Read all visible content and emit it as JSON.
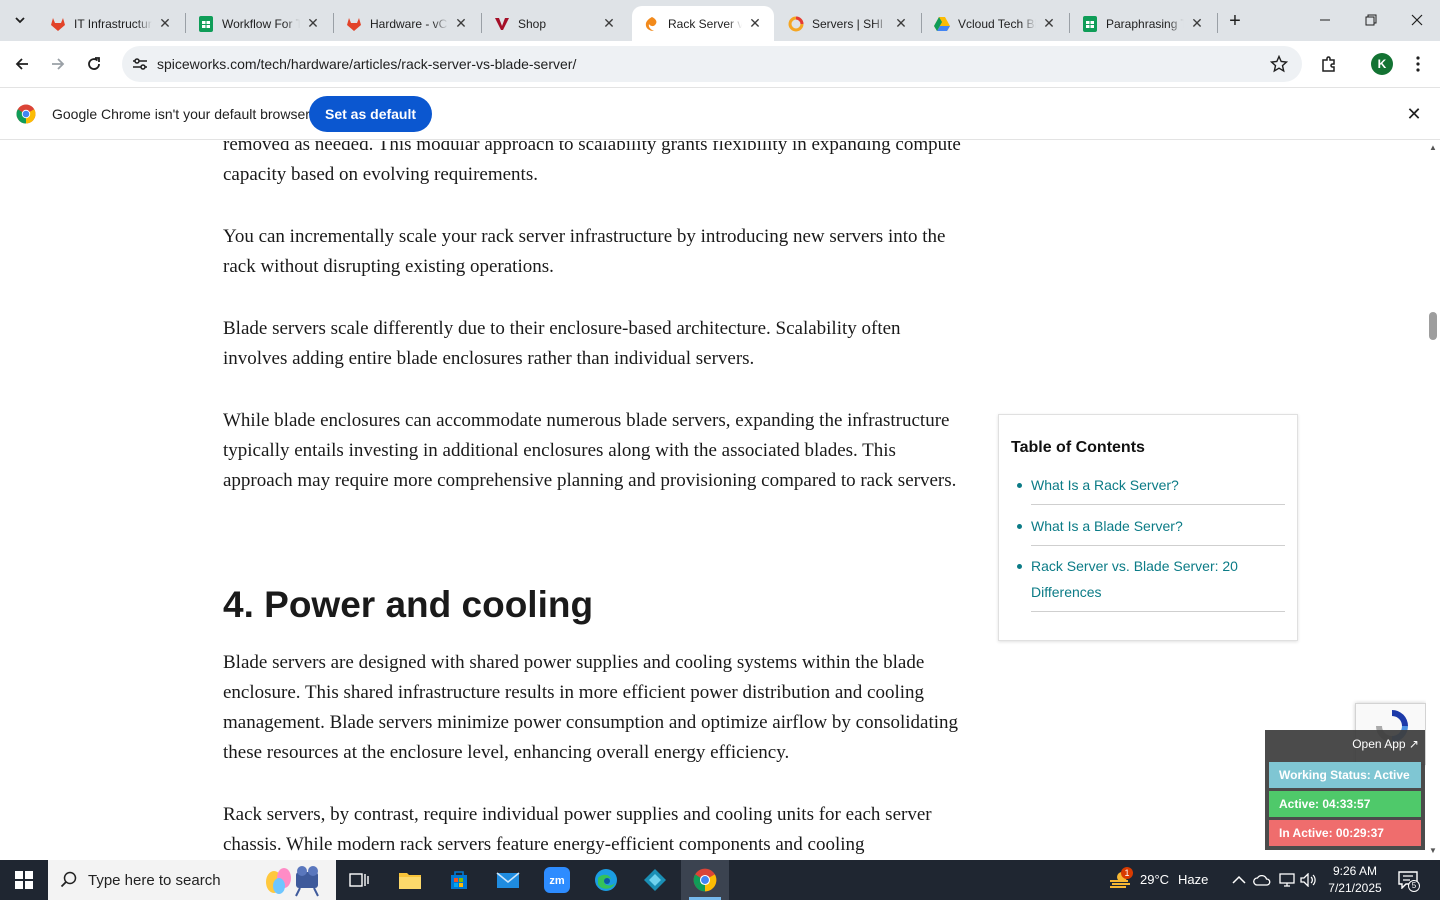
{
  "tabs": [
    {
      "title": "IT Infrastructure",
      "icon": "gitlab-icon"
    },
    {
      "title": "Workflow For Tech",
      "icon": "sheets-icon"
    },
    {
      "title": "Hardware - vCloud",
      "icon": "gitlab-icon"
    },
    {
      "title": "Shop",
      "icon": "v-logo-icon"
    },
    {
      "title": "Rack Server vs Blade",
      "icon": "spiceworks-icon"
    },
    {
      "title": "Servers | SHI",
      "icon": "shi-icon"
    },
    {
      "title": "Vcloud Tech Blog",
      "icon": "drive-icon"
    },
    {
      "title": "Paraphrasing Tool",
      "icon": "sheets-icon"
    }
  ],
  "toolbar": {
    "url": "spiceworks.com/tech/hardware/articles/rack-server-vs-blade-server/",
    "profile_initial": "K"
  },
  "infobar": {
    "message": "Google Chrome isn't your default browser",
    "button": "Set as default"
  },
  "article": {
    "p0": "removed as needed. This modular approach to scalability grants flexibility in expanding compute capacity based on evolving requirements.",
    "p1": "You can incrementally scale your rack server infrastructure by introducing new servers into the rack without disrupting existing operations.",
    "p2": "Blade servers scale differently due to their enclosure-based architecture. Scalability often involves adding entire blade enclosures rather than individual servers.",
    "p3": "While blade enclosures can accommodate numerous blade servers, expanding the infrastructure typically entails investing in additional enclosures along with the associated blades. This approach may require more comprehensive planning and provisioning compared to rack servers.",
    "heading": "4. Power and cooling",
    "p4": "Blade servers are designed with shared power supplies and cooling systems within the blade enclosure. This shared infrastructure results in more efficient power distribution and cooling management. Blade servers minimize power consumption and optimize airflow by consolidating these resources at the enclosure level, enhancing overall energy efficiency.",
    "p5": "Rack servers, by contrast, require individual power supplies and cooling units for each server chassis. While modern rack servers feature energy-efficient components and cooling"
  },
  "toc": {
    "title": "Table of Contents",
    "items": [
      "What Is a Rack Server?",
      "What Is a Blade Server?",
      "Rack Server vs. Blade Server: 20 Differences"
    ]
  },
  "tracker": {
    "open_app": "Open App ↗",
    "status": "Working Status: Active",
    "active": "Active: 04:33:57",
    "inactive": "In Active: 00:29:37"
  },
  "taskbar": {
    "search_placeholder": "Type here to search",
    "weather_badge": "1",
    "temperature": "29°C",
    "weather": "Haze",
    "time": "9:26 AM",
    "date": "7/21/2025",
    "notification_count": "5"
  },
  "colors": {
    "accent_blue": "#0b57d0",
    "link_teal": "#0b7b86",
    "taskbar": "#1f2631"
  }
}
